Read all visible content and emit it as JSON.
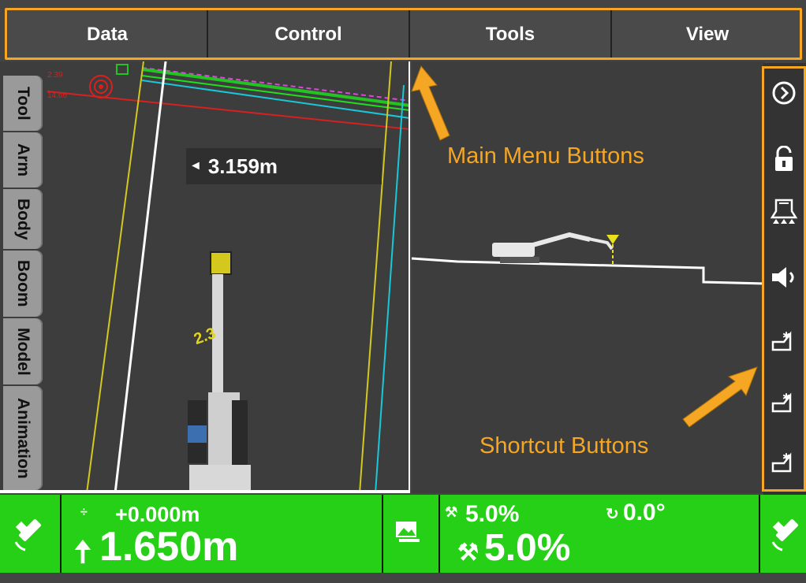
{
  "menu": {
    "items": [
      {
        "label": "Data"
      },
      {
        "label": "Control"
      },
      {
        "label": "Tools"
      },
      {
        "label": "View"
      }
    ]
  },
  "left_tabs": [
    "Tool",
    "Arm",
    "Body",
    "Boom",
    "Model",
    "Animation"
  ],
  "plan_view": {
    "distance": "3.159m",
    "bucket_label": "2.3",
    "small_labels": [
      "2.39",
      "14.66"
    ]
  },
  "annotations": {
    "main_menu": "Main Menu Buttons",
    "shortcut": "Shortcut Buttons"
  },
  "shortcuts": [
    {
      "icon": "chevron-right-circle-icon"
    },
    {
      "icon": "unlock-icon"
    },
    {
      "icon": "bucket-icon"
    },
    {
      "icon": "speaker-icon"
    },
    {
      "icon": "bucket-design-icon"
    },
    {
      "icon": "bucket-design-icon"
    },
    {
      "icon": "bucket-design-icon"
    }
  ],
  "status": {
    "elevation_offset": "+0.000m",
    "elevation": "1.650m",
    "slope_top": "5.0%",
    "rotation": "0.0°",
    "slope_main": "5.0%"
  },
  "colors": {
    "accent": "#f5a623",
    "status_green": "#26d016",
    "background": "#3d3d3d"
  }
}
